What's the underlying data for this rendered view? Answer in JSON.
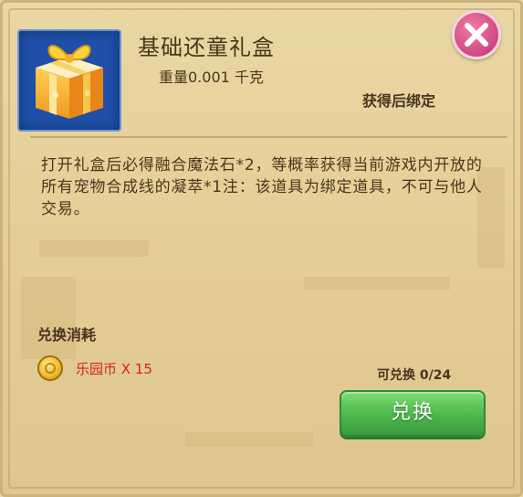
{
  "item": {
    "name": "基础还童礼盒",
    "weight": "重量0.001 千克",
    "bind_status": "获得后绑定",
    "icon": "gift-box-icon",
    "description": "打开礼盒后必得融合魔法石*2，等概率获得当前游戏内开放的所有宠物合成线的凝萃*1注：该道具为绑定道具，不可与他人交易。"
  },
  "exchange": {
    "cost_label": "兑换消耗",
    "currency_icon": "coin-icon",
    "currency_text": "乐园币 X 15",
    "available_text": "可兑换 0/24",
    "button_label": "兑换"
  },
  "close": {
    "icon": "close-icon"
  },
  "colors": {
    "panel": "#e5d29e",
    "text": "#4a351e",
    "currency_text": "#d4231a",
    "button_green": "#4cb84a",
    "close_pink": "#d64f86",
    "icon_frame_blue": "#1f4fa8"
  }
}
